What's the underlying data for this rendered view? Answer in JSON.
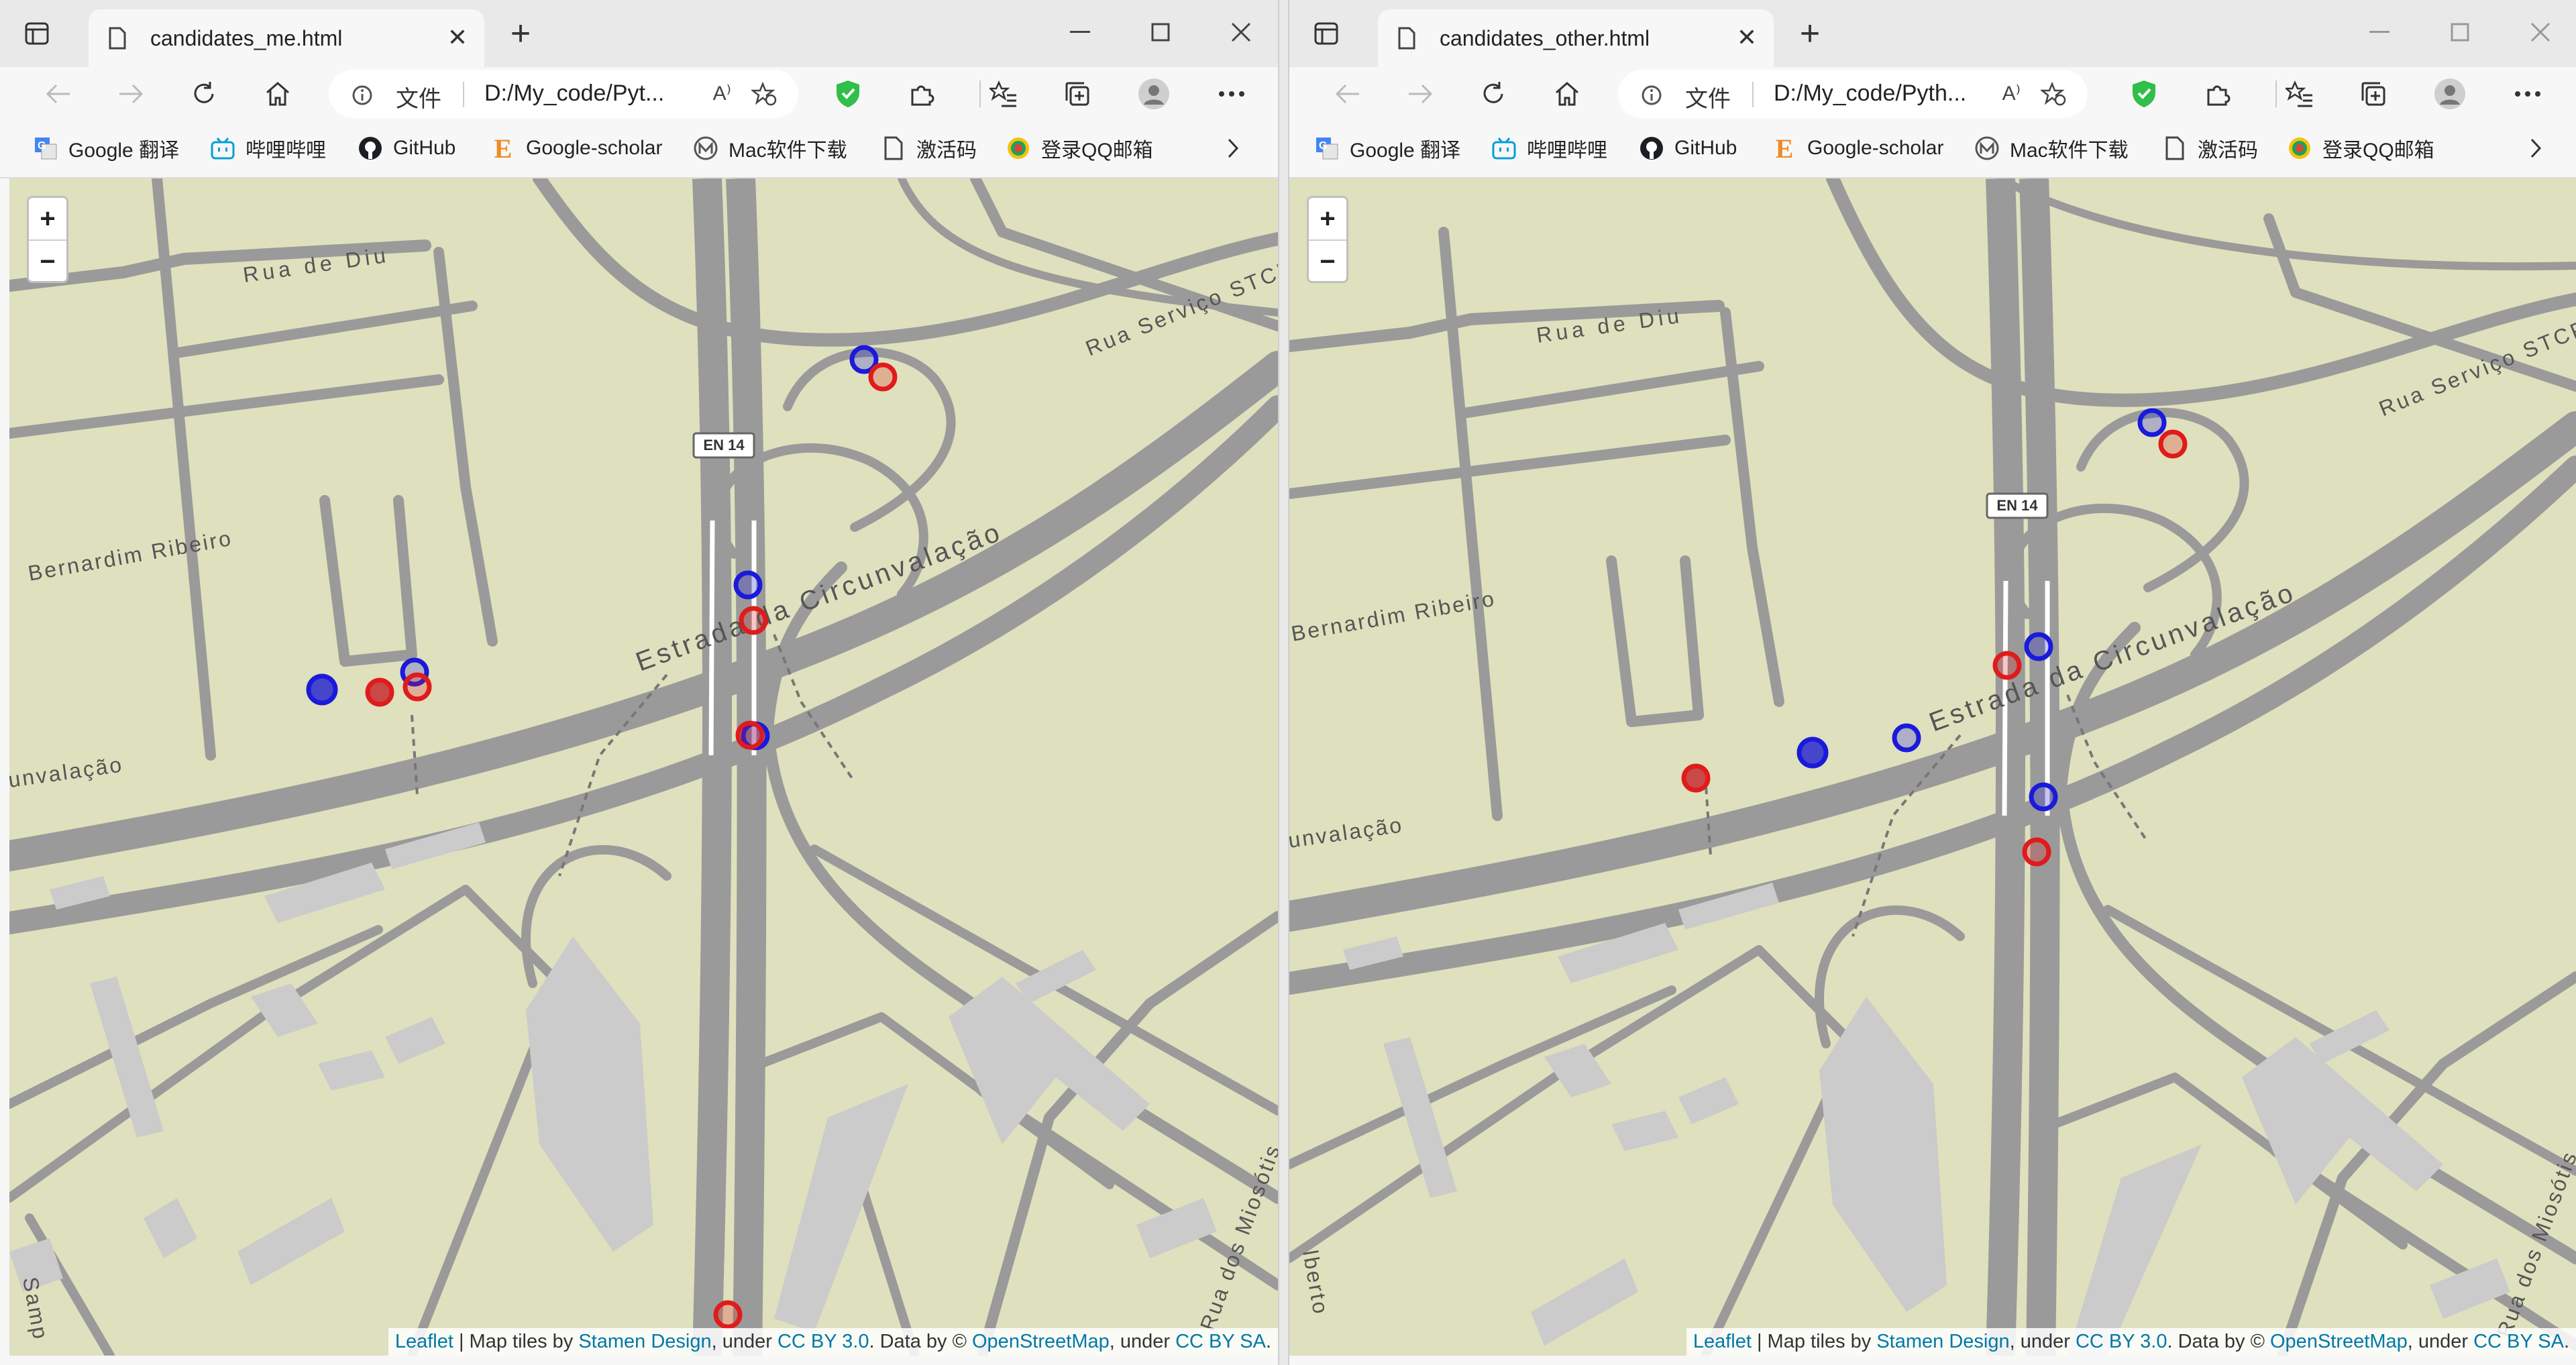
{
  "left_window": {
    "tab_title": "candidates_me.html",
    "address_label": "文件",
    "url": "D:/My_code/Pyt...",
    "aa": "A⁾",
    "bookmarks": [
      "Google 翻译",
      "哔哩哔哩",
      "GitHub",
      "Google-scholar",
      "Mac软件下载",
      "激活码",
      "登录QQ邮箱"
    ],
    "map": {
      "road_shield": "EN 14",
      "street_labels": [
        "Rua de Diu",
        "Rua Serviço STCP",
        "Bernardim Ribeiro",
        "Estrada da Circunvalação",
        "unvalação",
        "Rua dos Miosótis",
        "Samp"
      ]
    },
    "attribution": {
      "leaflet": "Leaflet",
      "t1": " | Map tiles by ",
      "stamen": "Stamen Design",
      "t2": ", under ",
      "cc30": "CC BY 3.0",
      "t3": ". Data by © ",
      "osm": "OpenStreetMap",
      "t4": ", under ",
      "ccsa": "CC BY SA",
      "t5": "."
    }
  },
  "right_window": {
    "tab_title": "candidates_other.html",
    "address_label": "文件",
    "url": "D:/My_code/Pyth...",
    "aa": "A⁾",
    "bookmarks": [
      "Google 翻译",
      "哔哩哔哩",
      "GitHub",
      "Google-scholar",
      "Mac软件下载",
      "激活码",
      "登录QQ邮箱"
    ],
    "map": {
      "road_shield": "EN 14",
      "street_labels": [
        "Rua de Diu",
        "Rua Serviço STCP",
        "Bernardim Ribeiro",
        "Estrada da Circunvalação",
        "unvalação",
        "Rua dos Miosótis",
        "lberto"
      ]
    },
    "attribution": {
      "leaflet": "Leaflet",
      "t1": " | Map tiles by ",
      "stamen": "Stamen Design",
      "t2": ", under ",
      "cc30": "CC BY 3.0",
      "t3": ". Data by © ",
      "osm": "OpenStreetMap",
      "t4": ", under ",
      "ccsa": "CC BY SA",
      "t5": "."
    }
  },
  "zoom": {
    "in": "+",
    "out": "−"
  },
  "colors": {
    "marker_blue": "#1a1adb",
    "marker_red": "#e01b1b",
    "map_bg": "#dfe0bd",
    "road": "#9a9a9a"
  }
}
